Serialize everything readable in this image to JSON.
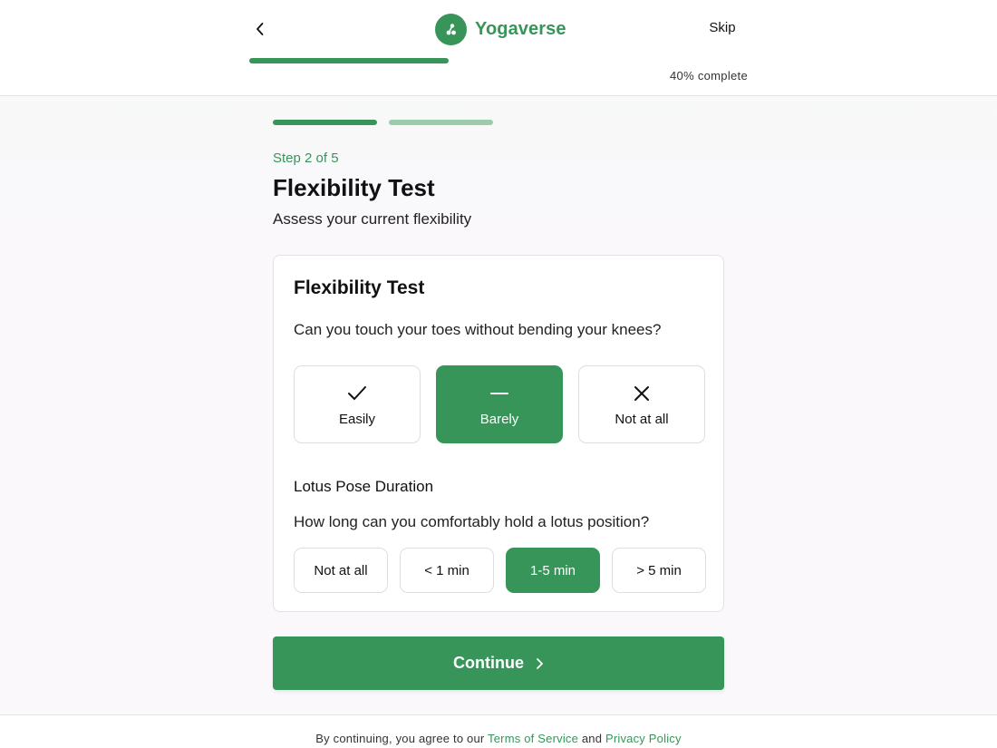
{
  "header": {
    "brand_name": "Yogaverse",
    "skip_label": "Skip",
    "progress_fraction": 0.4,
    "progress_text": "40% complete"
  },
  "stepper": {
    "segments": [
      "done",
      "current"
    ],
    "step_label": "Step 2 of 5",
    "title": "Flexibility Test",
    "subtitle": "Assess your current flexibility"
  },
  "card": {
    "title": "Flexibility Test",
    "question1": "Can you touch your toes without bending your knees?",
    "options1": [
      {
        "label": "Easily",
        "icon": "check-icon",
        "selected": false
      },
      {
        "label": "Barely",
        "icon": "minus-icon",
        "selected": true
      },
      {
        "label": "Not at all",
        "icon": "x-icon",
        "selected": false
      }
    ],
    "section2_title": "Lotus Pose Duration",
    "question2": "How long can you comfortably hold a lotus position?",
    "options2": [
      {
        "label": "Not at all",
        "selected": false
      },
      {
        "label": "< 1 min",
        "selected": false
      },
      {
        "label": "1-5 min",
        "selected": true
      },
      {
        "label": "> 5 min",
        "selected": false
      }
    ]
  },
  "continue_label": "Continue",
  "footer": {
    "prefix": "By continuing, you agree to our",
    "terms": "Terms of Service",
    "and": "and",
    "privacy": "Privacy Policy"
  },
  "colors": {
    "brand": "#37955a",
    "brand_light": "#9ccbad"
  }
}
